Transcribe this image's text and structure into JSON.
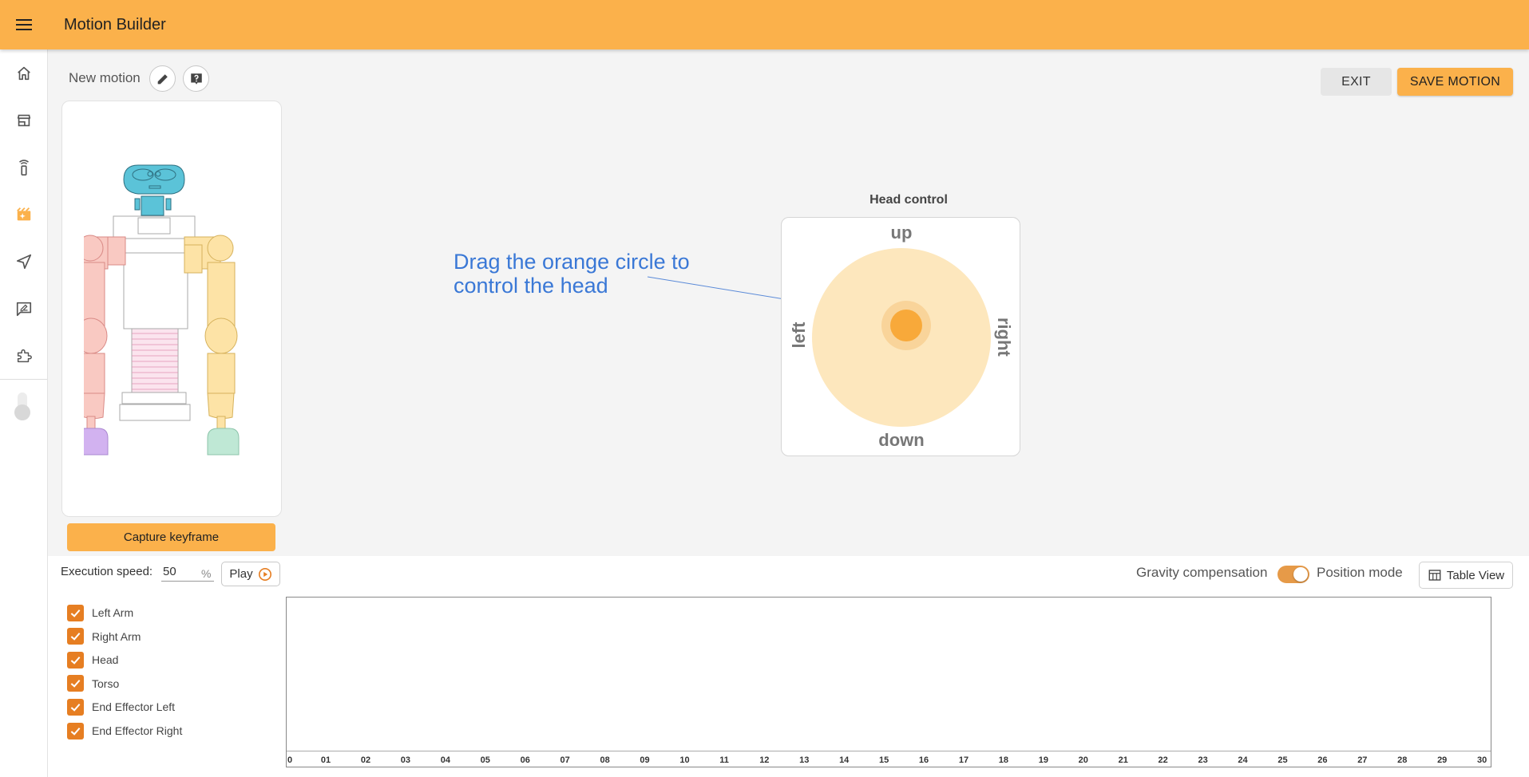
{
  "appbar": {
    "title": "Motion Builder",
    "menu_icon": "hamburger-menu-icon"
  },
  "sidebar": {
    "items": [
      {
        "name": "home",
        "icon": "home-icon",
        "active": false
      },
      {
        "name": "store",
        "icon": "store-icon",
        "active": false
      },
      {
        "name": "remote",
        "icon": "remote-icon",
        "active": false
      },
      {
        "name": "motion-builder",
        "icon": "motion-icon",
        "active": true
      },
      {
        "name": "navigation",
        "icon": "navigation-icon",
        "active": false
      },
      {
        "name": "feedback",
        "icon": "feedback-icon",
        "active": false
      },
      {
        "name": "extensions",
        "icon": "puzzle-icon",
        "active": false
      }
    ]
  },
  "header": {
    "motion_name": "New motion",
    "edit_icon": "pencil-icon",
    "help_icon": "help-icon",
    "exit_label": "EXIT",
    "save_label": "SAVE MOTION"
  },
  "robot_panel": {
    "capture_label": "Capture keyframe"
  },
  "hint": {
    "line1": "Drag the orange circle to",
    "line2": "control the head"
  },
  "head_control": {
    "title": "Head control",
    "up": "up",
    "down": "down",
    "left": "left",
    "right": "right"
  },
  "controls": {
    "speed_label": "Execution speed:",
    "speed_value": "50",
    "speed_unit": "%",
    "play_label": "Play",
    "gravity_label": "Gravity compensation",
    "gravity_enabled": true,
    "position_label": "Position mode",
    "table_view_label": "Table View"
  },
  "parts": [
    {
      "label": "Left Arm",
      "checked": true
    },
    {
      "label": "Right Arm",
      "checked": true
    },
    {
      "label": "Head",
      "checked": true
    },
    {
      "label": "Torso",
      "checked": true
    },
    {
      "label": "End Effector Left",
      "checked": true
    },
    {
      "label": "End Effector Right",
      "checked": true
    }
  ],
  "timeline": {
    "ticks": [
      "0",
      "01",
      "02",
      "03",
      "04",
      "05",
      "06",
      "07",
      "08",
      "09",
      "10",
      "11",
      "12",
      "13",
      "14",
      "15",
      "16",
      "17",
      "18",
      "19",
      "20",
      "21",
      "22",
      "23",
      "24",
      "25",
      "26",
      "27",
      "28",
      "29",
      "30"
    ]
  },
  "colors": {
    "accent": "#fbb14b",
    "checkbox": "#e67e22",
    "hint": "#3a78d6",
    "joystick": "#f8a93a"
  }
}
